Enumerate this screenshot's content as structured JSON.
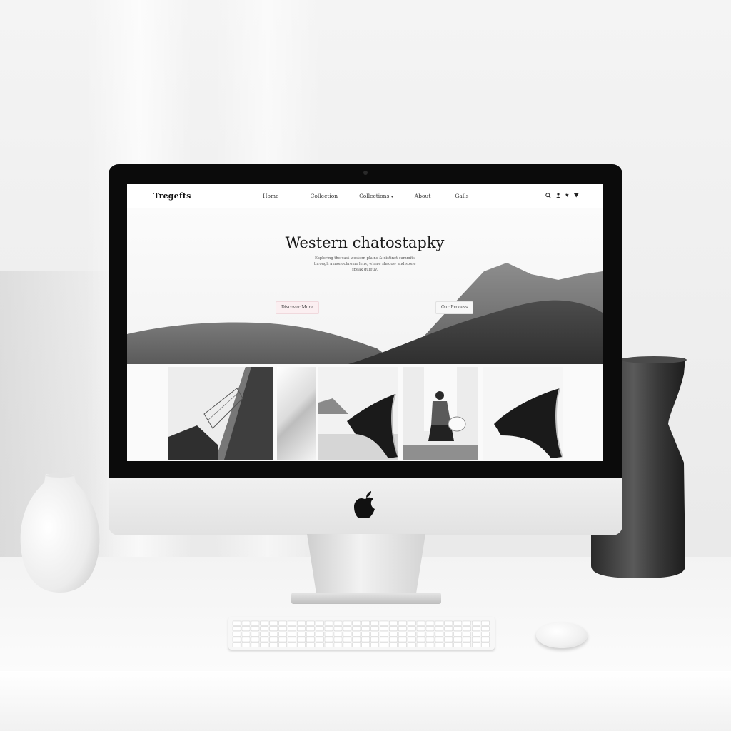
{
  "site": {
    "brand": "Tregefts",
    "nav": [
      {
        "label": "Home"
      },
      {
        "label": "Collection"
      },
      {
        "label": "Collections"
      },
      {
        "label": "About"
      },
      {
        "label": "Galls"
      }
    ],
    "tools": {
      "search_icon": "search-icon",
      "user_icon": "user-icon",
      "heart_icon": "heart-icon",
      "cart_icon": "cart-icon"
    }
  },
  "hero": {
    "title": "Western chatostapky",
    "description": "Exploring the vast western plains & distinct summits through a monochrome lens, where shadow and stone speak quietly.",
    "cta_primary": "Discover More",
    "cta_secondary": "Our Process"
  },
  "gallery": [
    {
      "subject": "architecture"
    },
    {
      "subject": "light"
    },
    {
      "subject": "sculpture"
    },
    {
      "subject": "portrait"
    },
    {
      "subject": "sculpture"
    }
  ],
  "hardware": {
    "apple_logo_icon": "apple-icon"
  },
  "colors": {
    "bezel": "#0b0b0b",
    "accent_pink": "#fbeff1",
    "ink": "#1a1a1a"
  }
}
